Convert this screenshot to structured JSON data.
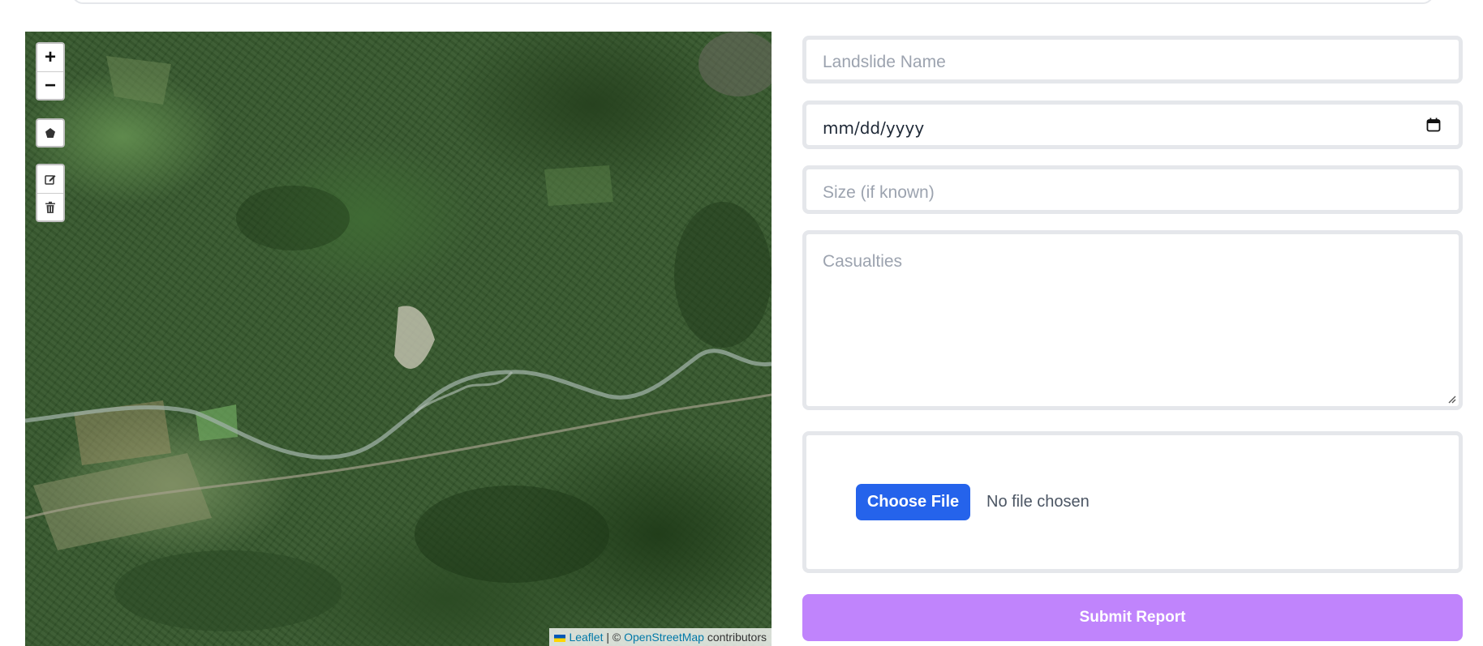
{
  "map": {
    "zoom_in_label": "+",
    "zoom_out_label": "−",
    "tools": {
      "draw_polygon_icon": "pentagon-icon",
      "edit_layers_icon": "edit-icon",
      "delete_layers_icon": "trash-icon"
    },
    "attribution": {
      "leaflet": "Leaflet",
      "separator": "| ©",
      "osm": "OpenStreetMap",
      "contributors": "contributors"
    }
  },
  "form": {
    "name_placeholder": "Landslide Name",
    "date_value": "mm/dd/yyyy",
    "size_placeholder": "Size (if known)",
    "casualties_placeholder": "Casualties",
    "file": {
      "button_label": "Choose File",
      "status": "No file chosen"
    },
    "submit_label": "Submit Report"
  },
  "colors": {
    "primary_button": "#2563eb",
    "submit_button": "#c084fc",
    "field_border": "#e5e7eb"
  }
}
